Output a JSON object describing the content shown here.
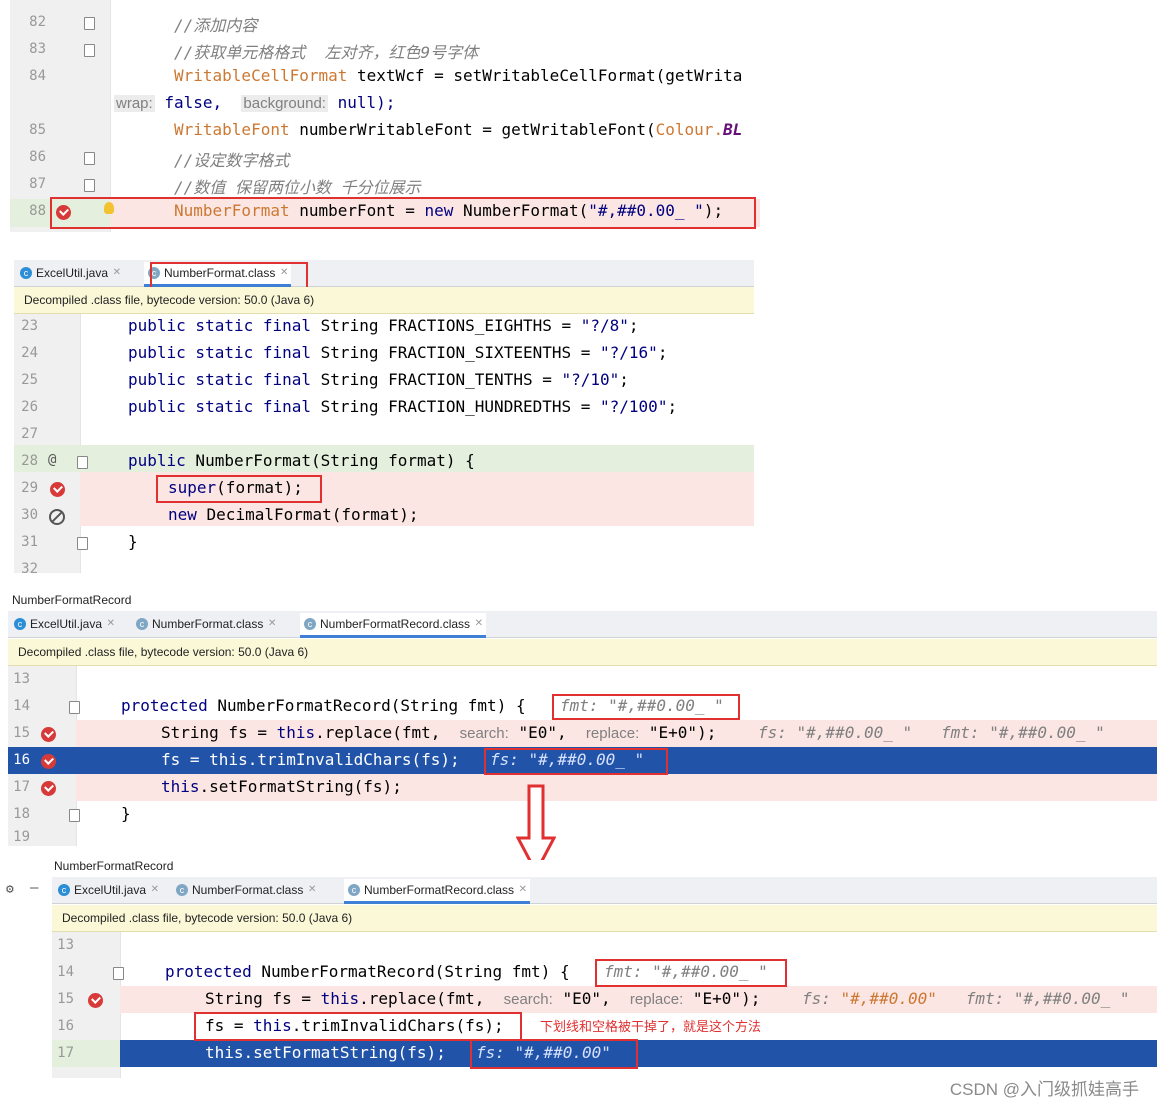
{
  "panel1": {
    "lines": [
      {
        "no": "82",
        "text": "//添加内容"
      },
      {
        "no": "83",
        "text": "//获取单元格格式  左对齐，红色9号字体"
      },
      {
        "no": "84",
        "text_pre": "WritableCellFormat",
        "text_mid": " textWcf = setWritableCellFormat(getWrita"
      },
      {
        "no": "",
        "hint1": "wrap:",
        "val1": " false,",
        "hint2": "background:",
        "val2": " null);"
      },
      {
        "no": "85",
        "text_pre": "WritableFont",
        "text_mid": " numberWritableFont = getWritableFont(",
        "text_post": "Colour.",
        "text_bl": "BL"
      },
      {
        "no": "86",
        "text": "//设定数字格式"
      },
      {
        "no": "87",
        "text": "//数值 保留两位小数 千分位展示"
      },
      {
        "no": "88",
        "text_pre": "NumberFormat",
        "text_mid": " numberFont = ",
        "text_kw": "new",
        "text_post": " NumberFormat(",
        "text_str": "\"#,##0.00_ \"",
        "text_end": ");"
      }
    ]
  },
  "panel2": {
    "tabs": [
      {
        "label": "ExcelUtil.java",
        "icon": "java-class-icon"
      },
      {
        "label": "NumberFormat.class",
        "icon": "class-file-icon",
        "active": true
      }
    ],
    "notice": "Decompiled .class file, bytecode version: 50.0 (Java 6)",
    "lines": [
      {
        "no": "23",
        "kw": "public static final",
        "rest": " String FRACTIONS_EIGHTHS = ",
        "str": "\"?/8\"",
        "end": ";"
      },
      {
        "no": "24",
        "kw": "public static final",
        "rest": " String FRACTION_SIXTEENTHS = ",
        "str": "\"?/16\"",
        "end": ";"
      },
      {
        "no": "25",
        "kw": "public static final",
        "rest": " String FRACTION_TENTHS = ",
        "str": "\"?/10\"",
        "end": ";"
      },
      {
        "no": "26",
        "kw": "public static final",
        "rest": " String FRACTION_HUNDREDTHS = ",
        "str": "\"?/100\"",
        "end": ";"
      },
      {
        "no": "27"
      },
      {
        "no": "28",
        "kw": "public",
        "rest": " NumberFormat(String format) {"
      },
      {
        "no": "29",
        "kw": "super",
        "rest": "(format);"
      },
      {
        "no": "30",
        "kw": "new",
        "rest": " DecimalFormat(format);"
      },
      {
        "no": "31",
        "rest": "}"
      },
      {
        "no": "32"
      }
    ]
  },
  "panel3": {
    "breadcrumb": "NumberFormatRecord",
    "tabs": [
      {
        "label": "ExcelUtil.java"
      },
      {
        "label": "NumberFormat.class"
      },
      {
        "label": "NumberFormatRecord.class",
        "active": true
      }
    ],
    "notice": "Decompiled .class file, bytecode version: 50.0 (Java 6)",
    "lines": [
      {
        "no": "13"
      },
      {
        "no": "14",
        "kw": "protected",
        "rest": " NumberFormatRecord(String fmt) {",
        "inline": "fmt: \"#,##0.00_ \""
      },
      {
        "no": "15",
        "pre": "String fs = ",
        "kw": "this",
        "rest": ".replace(fmt,",
        "h1": "search:",
        "v1": " \"E0\",",
        "h2": "replace:",
        "v2": " \"E+0\");",
        "inline": "fs: \"#,##0.00_ \"   fmt: \"#,##0.00_ \""
      },
      {
        "no": "16",
        "pre": "fs = ",
        "kw": "this",
        "rest": ".trimInvalidChars(fs);",
        "inline": "fs: \"#,##0.00_ \""
      },
      {
        "no": "17",
        "kw": "this",
        "rest": ".setFormatString(fs);"
      },
      {
        "no": "18",
        "rest": "}"
      },
      {
        "no": "19"
      }
    ]
  },
  "panel4": {
    "breadcrumb": "NumberFormatRecord",
    "tabs": [
      {
        "label": "ExcelUtil.java"
      },
      {
        "label": "NumberFormat.class"
      },
      {
        "label": "NumberFormatRecord.class",
        "active": true
      }
    ],
    "notice": "Decompiled .class file, bytecode version: 50.0 (Java 6)",
    "lines": [
      {
        "no": "13"
      },
      {
        "no": "14",
        "kw": "protected",
        "rest": " NumberFormatRecord(String fmt) {",
        "inline": "fmt: \"#,##0.00_ \""
      },
      {
        "no": "15",
        "pre": "String fs = ",
        "kw": "this",
        "rest": ".replace(fmt,",
        "h1": "search:",
        "v1": " \"E0\",",
        "h2": "replace:",
        "v2": " \"E+0\");",
        "inline_a": "fs: ",
        "inline_b": "\"#,##0.00\"",
        "inline_c": "   fmt: \"#,##0.00_ \""
      },
      {
        "no": "16",
        "pre": "fs = ",
        "kw": "this",
        "rest": ".trimInvalidChars(fs);"
      },
      {
        "no": "17",
        "kw": "this",
        "rest": ".setFormatString(fs);",
        "inline": "fs: \"#,##0.00\""
      }
    ],
    "annotation": "下划线和空格被干掉了，就是这个方法"
  },
  "watermark": "CSDN @入门级抓娃高手",
  "colors": {
    "error_line": "#fbe6e3",
    "current_line": "#2154a8",
    "annotation_red": "#e03030",
    "caret_row": "#e4efdd"
  }
}
